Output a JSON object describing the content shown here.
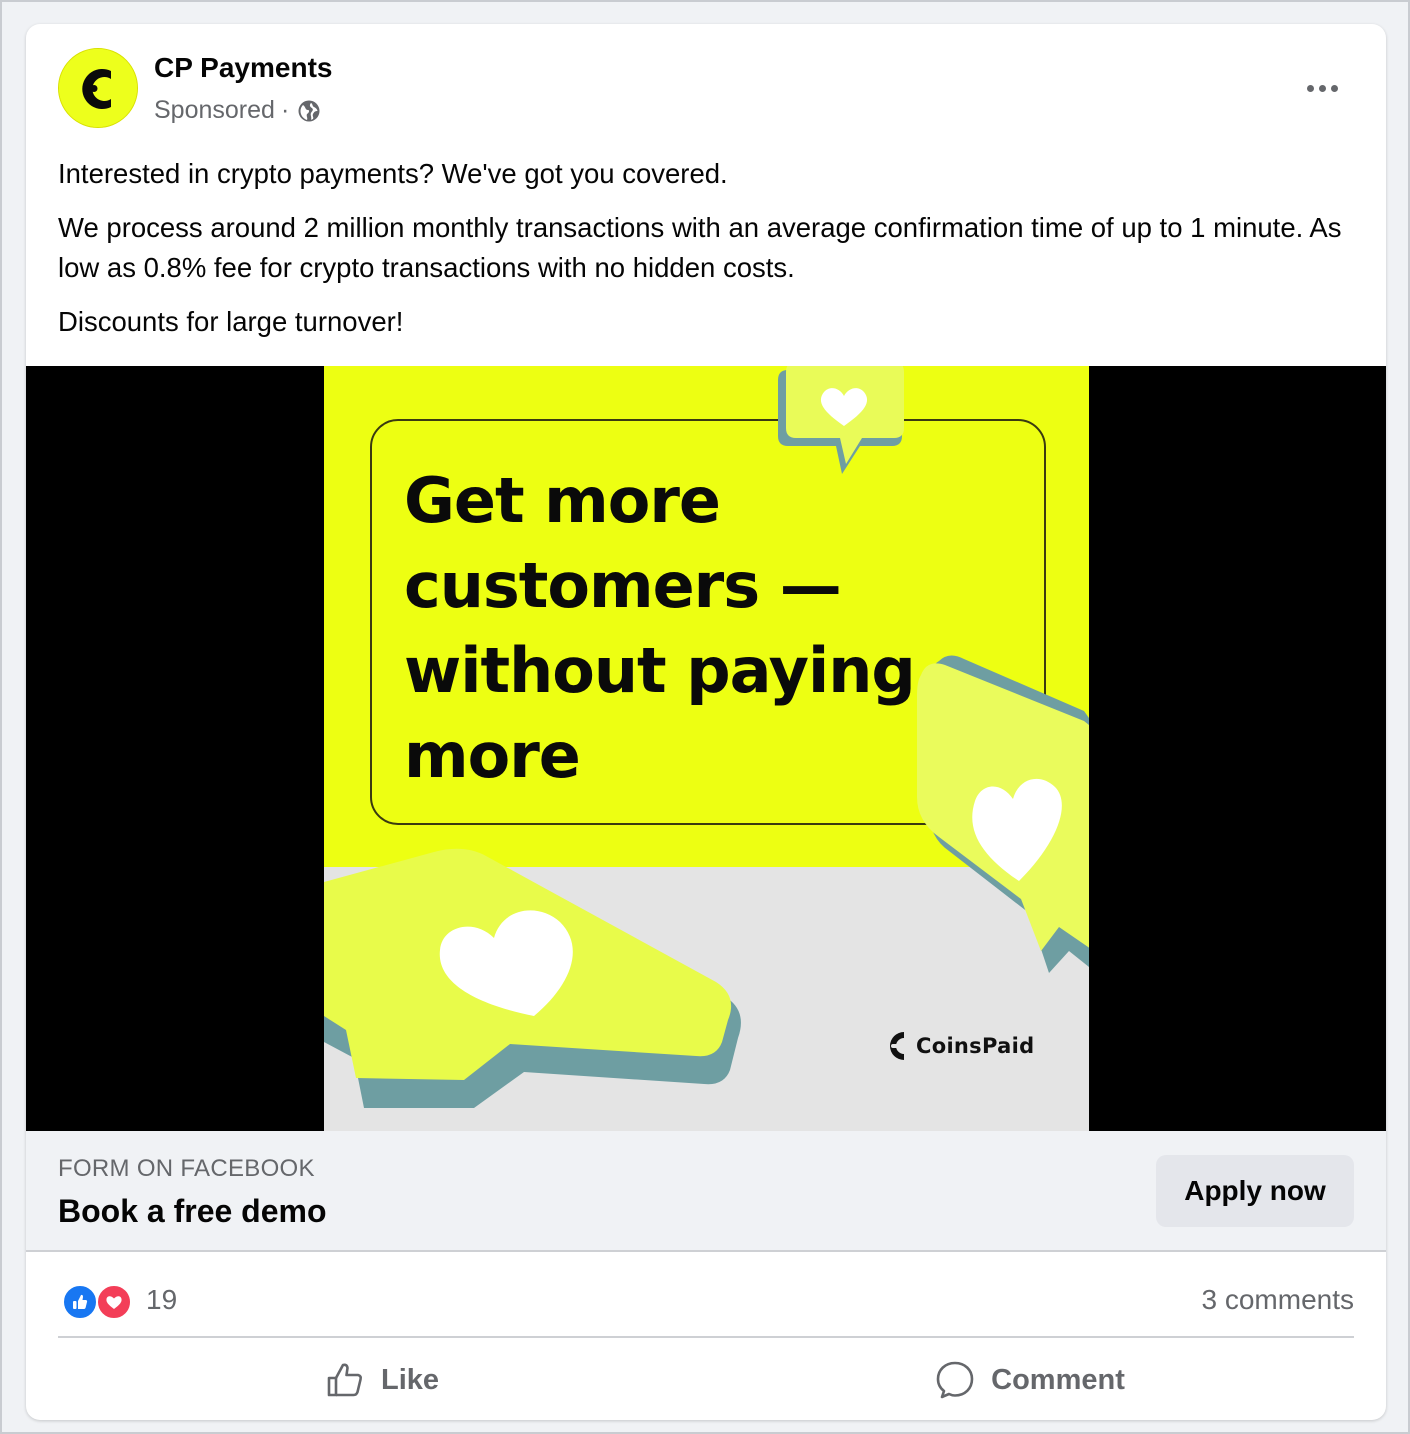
{
  "post": {
    "page_name": "CP Payments",
    "sponsored_label": "Sponsored",
    "separator": "·",
    "body": [
      "Interested in crypto payments? We've got you covered.",
      "We process around 2 million monthly transactions with an average confirmation time of up to 1 minute. As low as 0.8% fee for crypto transactions with no hidden costs.",
      "Discounts for large turnover!"
    ]
  },
  "creative": {
    "headline_lines": [
      "Get more",
      "customers —",
      "without paying",
      "more"
    ],
    "brand_name": "CoinsPaid",
    "accent_color": "#edff12"
  },
  "cta": {
    "caption": "FORM ON FACEBOOK",
    "title": "Book a free demo",
    "button_label": "Apply now"
  },
  "engagement": {
    "reaction_count": "19",
    "comments_label": "3 comments",
    "reaction_icons": [
      "like-icon",
      "love-icon"
    ]
  },
  "actions": {
    "like_label": "Like",
    "comment_label": "Comment"
  }
}
